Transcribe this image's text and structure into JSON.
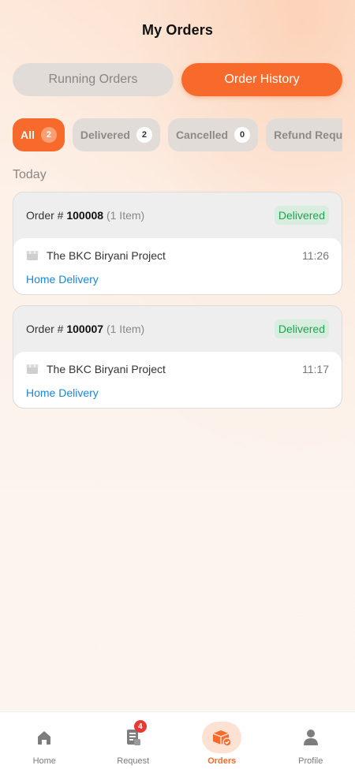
{
  "header": {
    "title": "My Orders"
  },
  "segments": [
    {
      "label": "Running Orders",
      "active": false
    },
    {
      "label": "Order History",
      "active": true
    }
  ],
  "filters": [
    {
      "label": "All",
      "count": "2",
      "active": true
    },
    {
      "label": "Delivered",
      "count": "2",
      "active": false
    },
    {
      "label": "Cancelled",
      "count": "0",
      "active": false
    },
    {
      "label": "Refund Reque",
      "count": "",
      "active": false
    }
  ],
  "section": {
    "label": "Today"
  },
  "orders": [
    {
      "prefix": "Order #",
      "number": "100008",
      "items": "(1 Item)",
      "status": "Delivered",
      "store": "The BKC Biryani Project",
      "time": "11:26",
      "delivery": "Home Delivery"
    },
    {
      "prefix": "Order #",
      "number": "100007",
      "items": "(1 Item)",
      "status": "Delivered",
      "store": "The BKC Biryani Project",
      "time": "11:17",
      "delivery": "Home Delivery"
    }
  ],
  "tabs": [
    {
      "label": "Home",
      "icon": "home-icon",
      "active": false
    },
    {
      "label": "Request",
      "icon": "request-icon",
      "active": false,
      "badge": "4"
    },
    {
      "label": "Orders",
      "icon": "orders-box-icon",
      "active": true
    },
    {
      "label": "Profile",
      "icon": "profile-icon",
      "active": false
    }
  ],
  "colors": {
    "accent": "#f76a2b",
    "delivered": "#1fa44c",
    "link": "#1c86d6"
  }
}
